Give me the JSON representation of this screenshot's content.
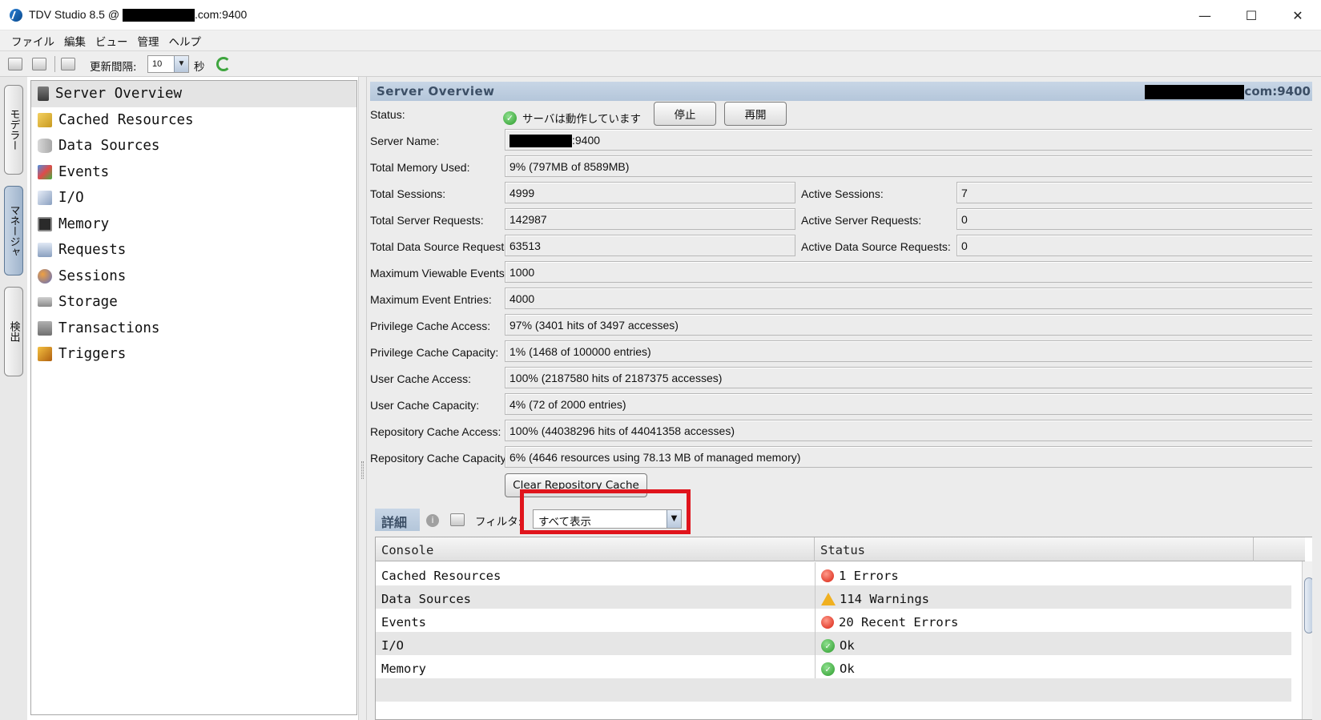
{
  "window": {
    "title_prefix": "TDV Studio 8.5 @",
    "title_suffix": ".com:9400",
    "minimize": "—",
    "maximize": "☐",
    "close": "✕"
  },
  "menu": [
    "ファイル",
    "編集",
    "ビュー",
    "管理",
    "ヘルプ"
  ],
  "toolbar": {
    "refresh_label": "更新間隔:",
    "refresh_value": "10",
    "unit": "秒"
  },
  "side_tabs": [
    {
      "label": "モデラー",
      "active": false
    },
    {
      "label": "マネージャ",
      "active": true
    },
    {
      "label": "検出",
      "active": false
    }
  ],
  "tree": {
    "items": [
      {
        "label": "Server Overview",
        "icon": "server-icon",
        "selected": true
      },
      {
        "label": "Cached Resources",
        "icon": "cache-icon",
        "selected": false
      },
      {
        "label": "Data Sources",
        "icon": "database-icon",
        "selected": false
      },
      {
        "label": "Events",
        "icon": "events-icon",
        "selected": false
      },
      {
        "label": "I/O",
        "icon": "io-icon",
        "selected": false
      },
      {
        "label": "Memory",
        "icon": "memory-icon",
        "selected": false
      },
      {
        "label": "Requests",
        "icon": "requests-icon",
        "selected": false
      },
      {
        "label": "Sessions",
        "icon": "sessions-icon",
        "selected": false
      },
      {
        "label": "Storage",
        "icon": "storage-icon",
        "selected": false
      },
      {
        "label": "Transactions",
        "icon": "transactions-icon",
        "selected": false
      },
      {
        "label": "Triggers",
        "icon": "triggers-icon",
        "selected": false
      }
    ]
  },
  "overview": {
    "title": "Server Overview",
    "host_suffix": "com:9400",
    "status_label": "Status:",
    "status_text": "サーバは動作しています",
    "stop_button": "停止",
    "restart_button": "再開",
    "server_name_label": "Server Name:",
    "server_name_suffix": ":9400",
    "total_memory_label": "Total Memory Used:",
    "total_memory_value": "9% (797MB of 8589MB)",
    "total_sessions_label": "Total Sessions:",
    "total_sessions_value": "4999",
    "active_sessions_label": "Active Sessions:",
    "active_sessions_value": "7",
    "total_server_requests_label": "Total Server Requests:",
    "total_server_requests_value": "142987",
    "active_server_requests_label": "Active Server Requests:",
    "active_server_requests_value": "0",
    "total_ds_requests_label": "Total Data Source Requests:",
    "total_ds_requests_value": "63513",
    "active_ds_requests_label": "Active Data Source Requests:",
    "active_ds_requests_value": "0",
    "max_viewable_events_label": "Maximum Viewable Events:",
    "max_viewable_events_value": "1000",
    "max_event_entries_label": "Maximum Event Entries:",
    "max_event_entries_value": "4000",
    "priv_cache_access_label": "Privilege Cache Access:",
    "priv_cache_access_value": "97% (3401 hits of 3497 accesses)",
    "priv_cache_capacity_label": "Privilege Cache Capacity:",
    "priv_cache_capacity_value": "1% (1468 of 100000 entries)",
    "user_cache_access_label": "User Cache Access:",
    "user_cache_access_value": "100% (2187580 hits of 2187375 accesses)",
    "user_cache_capacity_label": "User Cache Capacity:",
    "user_cache_capacity_value": "4% (72 of 2000 entries)",
    "repo_cache_access_label": "Repository Cache Access:",
    "repo_cache_access_value": "100% (44038296 hits of 44041358 accesses)",
    "repo_cache_capacity_label": "Repository Cache Capacity:",
    "repo_cache_capacity_value": "6% (4646 resources using 78.13 MB of managed memory)",
    "clear_cache_button": "Clear Repository Cache"
  },
  "details": {
    "tab_label": "詳細",
    "filter_label": "フィルタ:",
    "filter_value": "すべて表示",
    "columns": [
      "Console",
      "Status"
    ],
    "rows": [
      {
        "console": "Cached Resources",
        "status": "1 Errors",
        "level": "error"
      },
      {
        "console": "Data Sources",
        "status": "114 Warnings",
        "level": "warning"
      },
      {
        "console": "Events",
        "status": "20 Recent Errors",
        "level": "error"
      },
      {
        "console": "I/O",
        "status": "Ok",
        "level": "ok"
      },
      {
        "console": "Memory",
        "status": "Ok",
        "level": "ok"
      }
    ]
  },
  "colors": {
    "header_band": "#b4c6da",
    "header_text": "#3c4f66",
    "highlight": "#e0141c",
    "ok": "#2a9a2a",
    "error": "#d82010",
    "warning": "#f0b020"
  }
}
